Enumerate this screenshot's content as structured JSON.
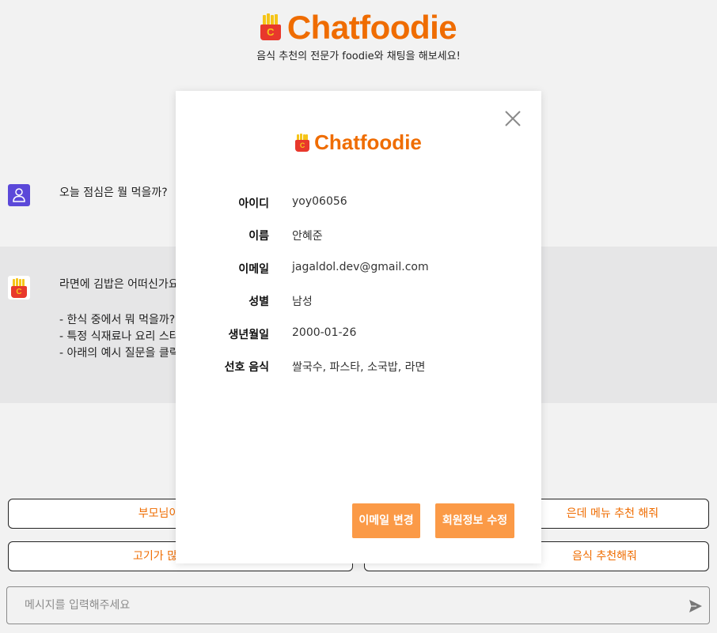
{
  "app": {
    "brand": "Chatfoodie",
    "tagline": "음식 추천의 전문가 foodie와 채팅을 해보세요!",
    "logo_letter": "C",
    "accent_color": "#ef6c00"
  },
  "chat": {
    "user_message": "오늘 점심은 뭘 먹을까?",
    "bot_message": "라면에 김밥은 어떠신가요",
    "bot_list": [
      "- 한식 중에서 뭐 먹을까?",
      "- 특정 식재료나 요리 스타",
      "- 아래의 예시 질문을 클릭"
    ]
  },
  "suggestions": [
    "부모님이랑 먹기",
    "은데 메뉴 추천 해줘",
    "고기가 많이 들어있",
    "음식 추천해줘"
  ],
  "input": {
    "placeholder": "메시지를 입력해주세요"
  },
  "modal": {
    "brand": "Chatfoodie",
    "fields": [
      {
        "label": "아이디",
        "value": "yoy06056"
      },
      {
        "label": "이름",
        "value": "안혜준"
      },
      {
        "label": "이메일",
        "value": "jagaldol.dev@gmail.com"
      },
      {
        "label": "성별",
        "value": "남성"
      },
      {
        "label": "생년월일",
        "value": "2000-01-26"
      },
      {
        "label": "선호 음식",
        "value": "쌀국수, 파스타, 소국밥, 라면"
      }
    ],
    "change_email_label": "이메일 변경",
    "edit_profile_label": "회원정보 수정"
  }
}
